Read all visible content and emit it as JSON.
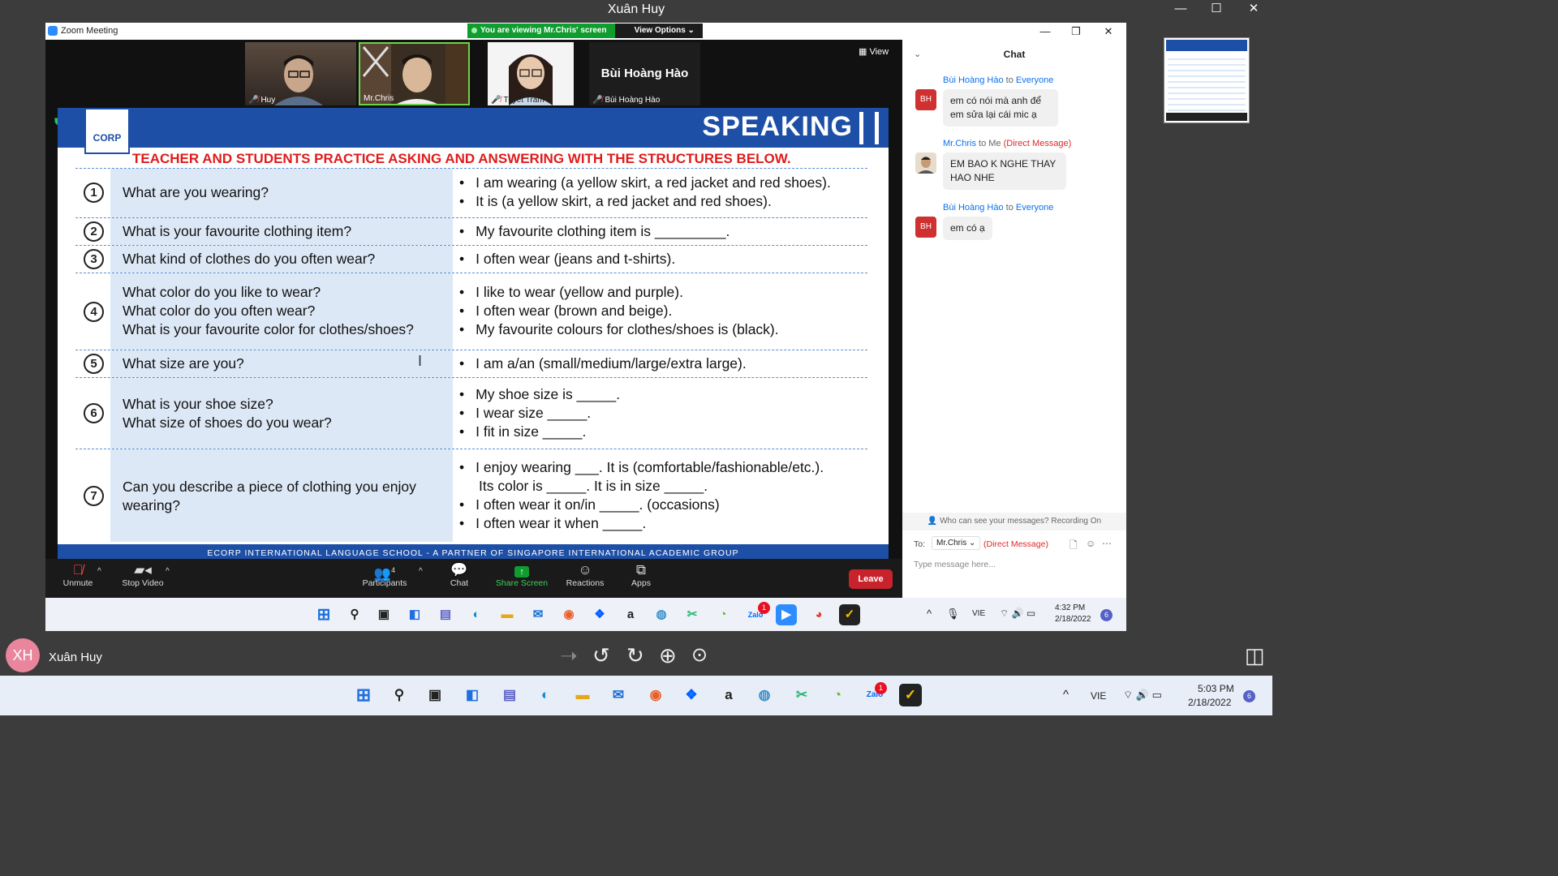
{
  "outer": {
    "title": "Xuân Huy"
  },
  "zoom": {
    "window_title": "Zoom Meeting",
    "viewing_banner": "You are viewing Mr.Chris' screen",
    "view_options": "View Options ⌄",
    "view_button": "View",
    "participants": [
      {
        "name": "Huy"
      },
      {
        "name": "Mr.Chris"
      },
      {
        "name": "Tuyết Trâm"
      },
      {
        "name": "Bùi Hoàng Hào",
        "big": "Bùi Hoàng Hào"
      }
    ]
  },
  "slide": {
    "logo": "CORP",
    "heading": "SPEAKING",
    "subtitle": "TEACHER AND STUDENTS PRACTICE ASKING AND ANSWERING WITH THE STRUCTURES BELOW.",
    "rows": [
      {
        "num": "1",
        "q": [
          "What are you wearing?"
        ],
        "a": [
          "I am wearing (a yellow skirt, a red jacket and red shoes).",
          "It is (a yellow skirt, a red jacket and red shoes)."
        ]
      },
      {
        "num": "2",
        "q": [
          "What is your favourite clothing item?"
        ],
        "a": [
          "My favourite clothing item is _________."
        ]
      },
      {
        "num": "3",
        "q": [
          "What kind of clothes do you often wear?"
        ],
        "a": [
          "I often wear (jeans and t-shirts)."
        ]
      },
      {
        "num": "4",
        "q": [
          "What color do you like to wear?",
          "What color do you often wear?",
          "What is your favourite color for clothes/shoes?"
        ],
        "a": [
          "I like to wear (yellow and purple).",
          "I often wear (brown and beige).",
          "My favourite colours for clothes/shoes is (black)."
        ]
      },
      {
        "num": "5",
        "q": [
          "What size are you?"
        ],
        "a": [
          "I am a/an (small/medium/large/extra large)."
        ]
      },
      {
        "num": "6",
        "q": [
          "What is your shoe size?",
          "What size of shoes do you wear?"
        ],
        "a": [
          "My shoe size is _____.",
          "I wear size _____.",
          "I fit in size _____."
        ]
      },
      {
        "num": "7",
        "q": [
          "Can you describe a piece of clothing you enjoy",
          "wearing?"
        ],
        "a": [
          "I enjoy wearing ___.  It is (comfortable/fashionable/etc.).",
          "Its color is _____.  It is in size _____.",
          "I often wear it on/in _____. (occasions)",
          "I often wear it when _____."
        ]
      }
    ],
    "footer": "ECORP INTERNATIONAL LANGUAGE SCHOOL - A PARTNER OF SINGAPORE INTERNATIONAL ACADEMIC GROUP"
  },
  "toolbar": {
    "unmute": "Unmute",
    "stop_video": "Stop Video",
    "participants": "Participants",
    "participant_count": "4",
    "chat": "Chat",
    "share": "Share Screen",
    "reactions": "Reactions",
    "apps": "Apps",
    "leave": "Leave"
  },
  "chat": {
    "title": "Chat",
    "messages": [
      {
        "from": "Bùi Hoàng Hào",
        "to_label": "to",
        "to": "Everyone",
        "avatar": "BH",
        "text": "em có nói mà anh để em sửa lại cái mic ạ"
      },
      {
        "from": "Mr.Chris",
        "to_label": "to Me",
        "to": "(Direct Message)",
        "avatar": "",
        "text": "EM BAO K NGHE THAY HAO NHE"
      },
      {
        "from": "Bùi Hoàng Hào",
        "to_label": "to",
        "to": "Everyone",
        "avatar": "BH",
        "text": "em có ạ"
      }
    ],
    "who_can_see": "Who can see your messages? Recording On",
    "to_label": "To:",
    "to_value": "Mr.Chris ⌄",
    "to_dm": "(Direct Message)",
    "placeholder": "Type message here..."
  },
  "inner_taskbar": {
    "lang": "VIE",
    "time": "4:32 PM",
    "date": "2/18/2022",
    "notif": "6",
    "zalo_badge": "1"
  },
  "viewer": {
    "initials": "XH",
    "name": "Xuân Huy"
  },
  "outer_taskbar": {
    "lang": "VIE",
    "time": "5:03 PM",
    "date": "2/18/2022",
    "notif": "6",
    "zalo_badge": "1"
  },
  "colors": {
    "zoom_blue": "#2d8cff",
    "slide_blue": "#1d4fa6",
    "slide_red": "#e01b1b",
    "leave_red": "#c8232c",
    "share_green": "#0f9d2f"
  }
}
